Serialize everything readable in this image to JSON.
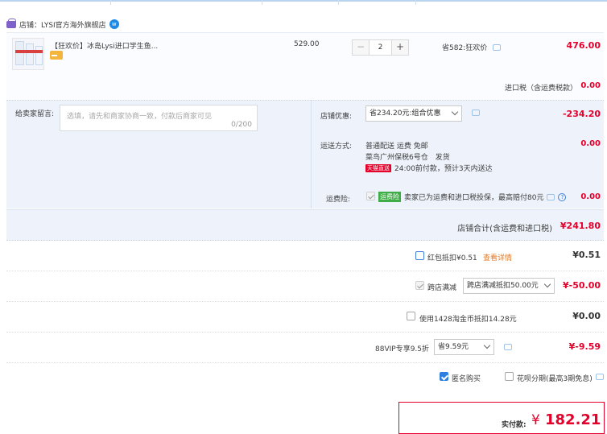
{
  "store": {
    "label": "店铺：LYSI官方海外旗舰店"
  },
  "item": {
    "title": "【狂欢价】冰岛Lysi进口学生鱼...",
    "unit_price": "529.00",
    "quantity": "2",
    "discount_text": "省582:狂欢价",
    "subtotal": "476.00",
    "tax_label": "进口税（含运费税款）",
    "tax_value": "0.00"
  },
  "message": {
    "label": "给卖家留言:",
    "placeholder": "选填，请先和商家协商一致，付款后商家可见",
    "counter": "0/200"
  },
  "store_coupon": {
    "label": "店铺优惠:",
    "selected": "省234.20元:组合优惠",
    "value": "-234.20"
  },
  "shipping": {
    "label": "运送方式:",
    "line1": "普通配送 运费 免邮",
    "line2": "菜鸟广州保税6号仓　发货",
    "badge": "天猫直送",
    "line3": "24:00前付款，预计3天内送达",
    "value": "0.00"
  },
  "insurance": {
    "label": "运费险:",
    "tag": "运费险",
    "text": "卖家已为运费和进口税投保，最高赔付80元",
    "value": "0.00"
  },
  "store_total": {
    "label": "店铺合计(含运费和进口税)",
    "value": "¥241.80"
  },
  "red_packet": {
    "label": "红包抵扣¥0.51",
    "link": "查看详情",
    "value": "¥0.51"
  },
  "cross_store": {
    "label": "跨店满减",
    "selected": "跨店满减抵扣50.00元",
    "value": "¥-50.00"
  },
  "coins": {
    "label": "使用1428淘金币抵扣14.28元",
    "value": "¥0.00"
  },
  "vip": {
    "label": "88VIP专享9.5折",
    "selected": "省9.59元",
    "value": "¥-9.59"
  },
  "anonymous": {
    "label": "匿名购买"
  },
  "installment": {
    "label": "花呗分期(最高3期免息)"
  },
  "payable": {
    "label": "实付款:",
    "currency": "¥",
    "amount": "182.21"
  },
  "colors": {
    "accent_red": "#e4002b",
    "link_blue": "#2d7fe0",
    "panel_blue": "#eef3fb"
  }
}
